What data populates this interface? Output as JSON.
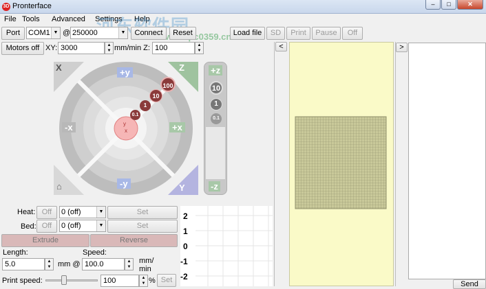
{
  "window": {
    "title": "Pronterface",
    "app_icon": "3D",
    "min": "–",
    "max": "□",
    "close": "✕"
  },
  "menu": [
    {
      "label": "File",
      "x": 6
    },
    {
      "label": "Tools",
      "x": 32
    },
    {
      "label": "Advanced",
      "x": 70
    },
    {
      "label": "Settings",
      "x": 125
    },
    {
      "label": "Help",
      "x": 190
    }
  ],
  "connection": {
    "port_label": "Port",
    "port_value": "COM1",
    "at_label": "@",
    "baud_value": "250000",
    "connect_label": "Connect",
    "reset_label": "Reset"
  },
  "file_toolbar": {
    "load_label": "Load file",
    "sd_label": "SD",
    "print_label": "Print",
    "pause_label": "Pause",
    "off_label": "Off"
  },
  "motion": {
    "motors_off_label": "Motors off",
    "xy_label": "XY:",
    "xy_value": "3000",
    "unit_label": "mm/min Z:",
    "z_value": "100"
  },
  "jog": {
    "home_x": "X",
    "home_z": "Z",
    "home_y": "Y",
    "plus_y": "+y",
    "minus_y": "-y",
    "plus_x": "+x",
    "minus_x": "-x",
    "center_x": "x",
    "center_y": "y",
    "steps": [
      "100",
      "10",
      "1",
      "0.1"
    ]
  },
  "zjog": {
    "plus_z": "+z",
    "minus_z": "-z",
    "steps": [
      "10",
      "1",
      "0.1"
    ]
  },
  "temps": {
    "heat_label": "Heat:",
    "heat_off": "Off",
    "heat_value": "0 (off)",
    "heat_set": "Set",
    "bed_label": "Bed:",
    "bed_off": "Off",
    "bed_value": "0 (off)",
    "bed_set": "Set"
  },
  "extrude": {
    "extrude_label": "Extrude",
    "reverse_label": "Reverse",
    "length_label": "Length:",
    "speed_label": "Speed:",
    "length_value": "5.0",
    "mm_at_label": "mm @",
    "speed_value": "100.0",
    "mm_min_label_1": "mm/",
    "mm_min_label_2": "min"
  },
  "print_speed": {
    "label": "Print speed:",
    "value": "100",
    "percent": "%",
    "set_label": "Set",
    "slider_position": 0.33
  },
  "graph": {
    "y_ticks": [
      "2",
      "1",
      "0",
      "-1",
      "-2"
    ]
  },
  "panel_toggles": {
    "left": "<",
    "right": ">"
  },
  "console": {
    "send_label": "Send"
  },
  "watermark": {
    "text": "河东软件园",
    "url": "www.pc0359.cn"
  },
  "colors": {
    "extrude_bg": "#d9b8b8",
    "build_plate": "#fafac8",
    "bed_grid": "#c8c89a"
  }
}
